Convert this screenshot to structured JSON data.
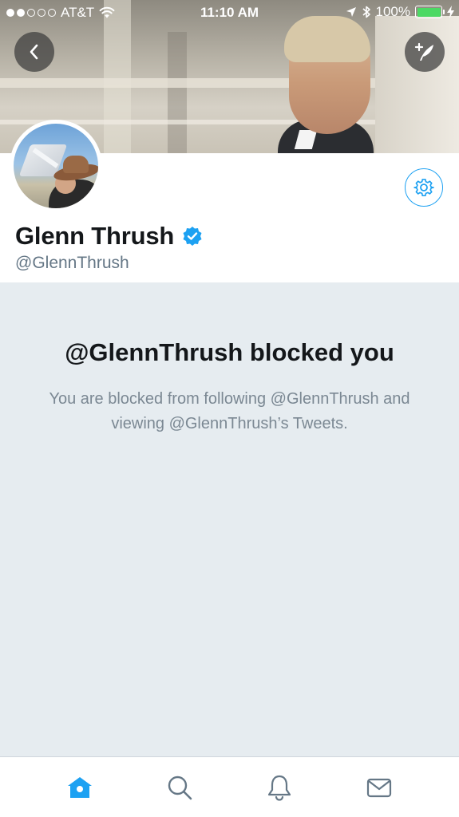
{
  "status_bar": {
    "carrier": "AT&T",
    "time": "11:10 AM",
    "battery": "100%",
    "signal_bars_filled": 2,
    "signal_bars_total": 5,
    "battery_level": 1.0
  },
  "profile": {
    "name": "Glenn Thrush",
    "handle": "@GlennThrush",
    "verified": true
  },
  "blocked": {
    "title": "@GlennThrush blocked you",
    "description": "You are blocked from following @GlennThrush and viewing @GlennThrush’s Tweets."
  },
  "icons": {
    "back": "chevron-left-icon",
    "compose": "compose-tweet-icon",
    "settings": "gear-icon",
    "verified": "verified-badge-icon",
    "home": "home-icon",
    "search": "search-icon",
    "notifications": "bell-icon",
    "messages": "envelope-icon"
  },
  "colors": {
    "accent": "#1da1f2",
    "background": "#e6ecf0",
    "primary_text": "#14171a",
    "secondary_text": "#657786",
    "battery_green": "#4cd964"
  }
}
